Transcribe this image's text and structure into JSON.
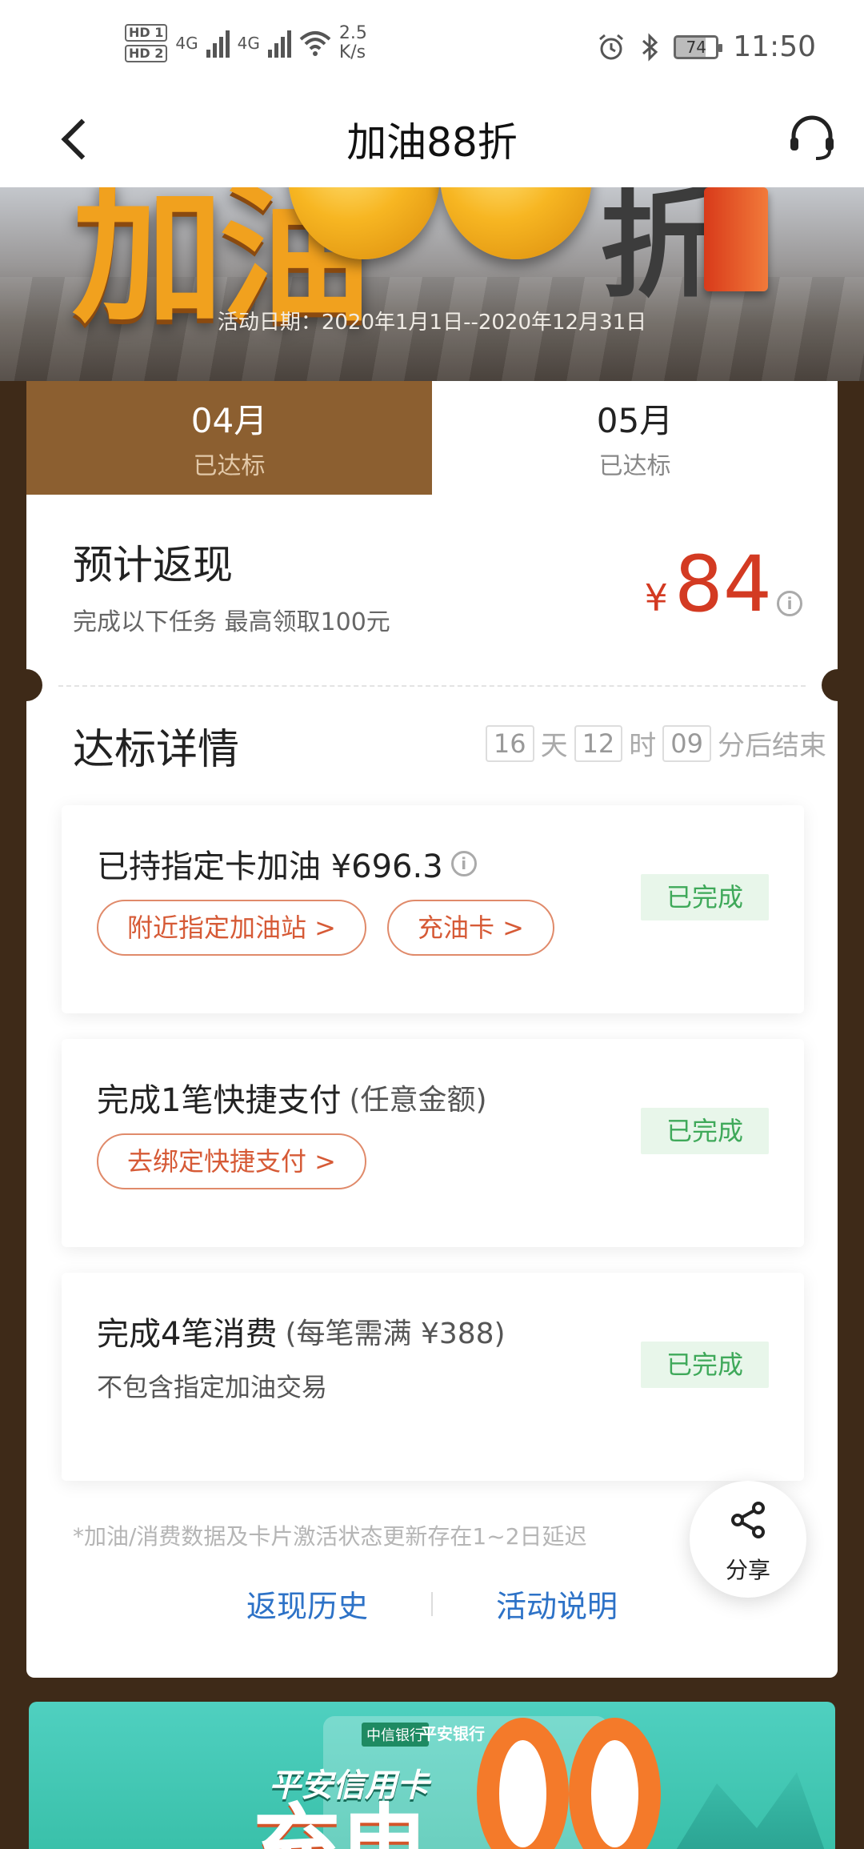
{
  "status_bar": {
    "sim1": "HD 1",
    "sim2": "HD 2",
    "net1": "4G",
    "net2": "4G",
    "speed_value": "2.5",
    "speed_unit": "K/s",
    "battery": "74",
    "time": "11:50"
  },
  "header": {
    "title": "加油88折"
  },
  "banner": {
    "headline_left": "加油",
    "headline_right": "折",
    "date_range": "活动日期：2020年1月1日--2020年12月31日"
  },
  "tabs": [
    {
      "month": "04月",
      "status": "已达标"
    },
    {
      "month": "05月",
      "status": "已达标"
    }
  ],
  "estimate": {
    "title": "预计返现",
    "subtitle": "完成以下任务 最高领取100元",
    "currency": "¥",
    "amount": "84"
  },
  "details": {
    "title": "达标详情",
    "days": "16",
    "day_unit": "天",
    "hours": "12",
    "hour_unit": "时",
    "minutes": "09",
    "end_text": "分后结束"
  },
  "tasks": [
    {
      "title": "已持指定卡加油 ¥696.3",
      "buttons": [
        "附近指定加油站 >",
        "充油卡 >"
      ],
      "status": "已完成"
    },
    {
      "title": "完成1笔快捷支付",
      "note": "(任意金额)",
      "buttons": [
        "去绑定快捷支付 >"
      ],
      "status": "已完成"
    },
    {
      "title": "完成4笔消费",
      "note": "(每笔需满 ¥388)",
      "subtitle": "不包含指定加油交易",
      "status": "已完成"
    }
  ],
  "footnote": "*加油/消费数据及卡片激活状态更新存在1~2日延迟",
  "links": {
    "history": "返现历史",
    "rules": "活动说明"
  },
  "share": {
    "label": "分享"
  },
  "ad": {
    "logo_a": "中信银行",
    "logo_b": "平安银行",
    "title": "平安信用卡",
    "big_text": "充电"
  },
  "colors": {
    "accent_brown": "#8c5f30",
    "page_bg": "#3e2a18",
    "amount_red": "#d33a22",
    "done_green": "#3fa95a",
    "link_blue": "#2d72c7"
  }
}
